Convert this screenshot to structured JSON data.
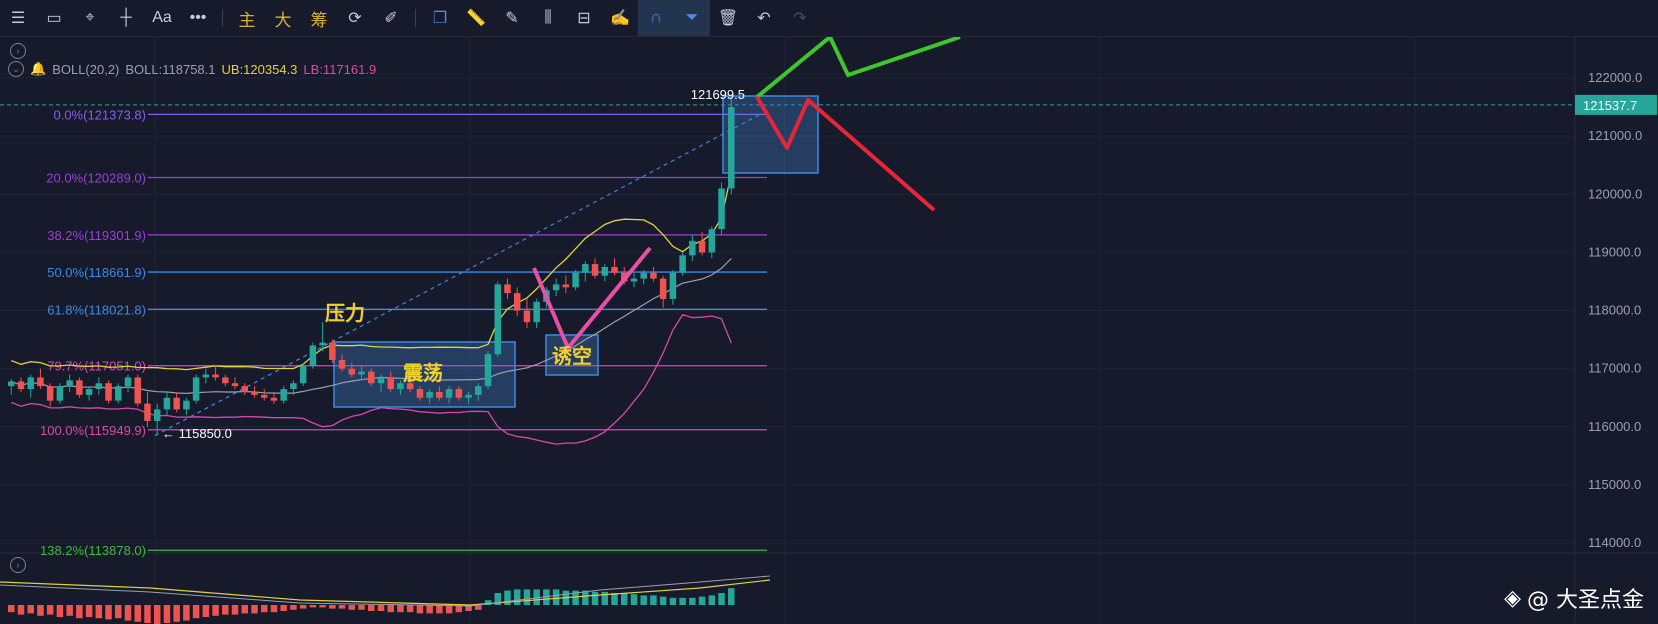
{
  "toolbar": {
    "main_label": "主",
    "big_label": "大",
    "chip_label": "筹",
    "text_tool_label": "Aa"
  },
  "indicator": {
    "name": "BOLL(20,2)",
    "boll": "BOLL:118758.1",
    "ub": "UB:120354.3",
    "lb": "LB:117161.9",
    "colors": {
      "boll": "#9aa0ae",
      "ub": "#e0d23a",
      "lb": "#d94aa8"
    }
  },
  "watermark": "@ 大圣点金",
  "chart_data": {
    "type": "candlestick",
    "y_axis": {
      "range": [
        113600,
        122600
      ],
      "ticks": [
        "122000.0",
        "121000.0",
        "120000.0",
        "119000.0",
        "118000.0",
        "117000.0",
        "116000.0",
        "115000.0",
        "114000.0"
      ],
      "tick_values": [
        122000,
        121000,
        120000,
        119000,
        118000,
        117000,
        116000,
        115000,
        114000
      ]
    },
    "current_price": "121537.7",
    "current_price_value": 121537.7,
    "high_label": "121699.5",
    "low_label": "115850.0",
    "fib_levels": [
      {
        "label": "0.0%(121373.8)",
        "value": 121373.8,
        "color": "#8a5cf0"
      },
      {
        "label": "20.0%(120289.0)",
        "value": 120289.0,
        "color": "#9b3fd8"
      },
      {
        "label": "38.2%(119301.9)",
        "value": 119301.9,
        "color": "#9b3fd8"
      },
      {
        "label": "50.0%(118661.9)",
        "value": 118661.9,
        "color": "#3d8ae0"
      },
      {
        "label": "61.8%(118021.8)",
        "value": 118021.8,
        "color": "#3d8ae0"
      },
      {
        "label": "79.7%(117051.0)",
        "value": 117051.0,
        "color": "#d94aa8"
      },
      {
        "label": "100.0%(115949.9)",
        "value": 115949.9,
        "color": "#d94aa8"
      },
      {
        "label": "138.2%(113878.0)",
        "value": 113878.0,
        "color": "#3fb83f"
      }
    ],
    "annotations": [
      {
        "text": "压力",
        "color": "#f2d22a"
      },
      {
        "text": "震荡",
        "color": "#f2d22a"
      },
      {
        "text": "诱空",
        "color": "#f2d22a"
      }
    ],
    "candles": [
      [
        116700,
        116820,
        116550,
        116780
      ],
      [
        116780,
        116850,
        116600,
        116650
      ],
      [
        116650,
        116900,
        116500,
        116850
      ],
      [
        116850,
        117000,
        116650,
        116700
      ],
      [
        116700,
        116750,
        116350,
        116450
      ],
      [
        116450,
        116750,
        116400,
        116700
      ],
      [
        116700,
        116900,
        116600,
        116800
      ],
      [
        116800,
        116850,
        116500,
        116550
      ],
      [
        116550,
        116700,
        116450,
        116650
      ],
      [
        116650,
        116850,
        116550,
        116750
      ],
      [
        116750,
        116800,
        116400,
        116450
      ],
      [
        116450,
        116750,
        116400,
        116700
      ],
      [
        116700,
        116900,
        116600,
        116850
      ],
      [
        116850,
        116900,
        116350,
        116400
      ],
      [
        116400,
        116600,
        116000,
        116100
      ],
      [
        116100,
        116400,
        115850,
        116300
      ],
      [
        116300,
        116600,
        116200,
        116500
      ],
      [
        116500,
        116600,
        116250,
        116300
      ],
      [
        116300,
        116500,
        116200,
        116450
      ],
      [
        116450,
        116900,
        116400,
        116850
      ],
      [
        116850,
        117000,
        116750,
        116900
      ],
      [
        116900,
        117050,
        116800,
        116850
      ],
      [
        116850,
        116900,
        116700,
        116750
      ],
      [
        116750,
        116850,
        116650,
        116700
      ],
      [
        116700,
        116750,
        116550,
        116600
      ],
      [
        116600,
        116700,
        116500,
        116550
      ],
      [
        116550,
        116650,
        116450,
        116500
      ],
      [
        116500,
        116600,
        116400,
        116450
      ],
      [
        116450,
        116700,
        116400,
        116650
      ],
      [
        116650,
        116800,
        116550,
        116750
      ],
      [
        116750,
        117100,
        116700,
        117050
      ],
      [
        117050,
        117450,
        117000,
        117400
      ],
      [
        117400,
        117800,
        117300,
        117450
      ],
      [
        117450,
        117500,
        117100,
        117150
      ],
      [
        117150,
        117250,
        116950,
        117000
      ],
      [
        117000,
        117100,
        116850,
        116900
      ],
      [
        116900,
        117050,
        116800,
        116950
      ],
      [
        116950,
        117000,
        116700,
        116750
      ],
      [
        116750,
        116900,
        116600,
        116850
      ],
      [
        116850,
        116950,
        116600,
        116650
      ],
      [
        116650,
        116800,
        116550,
        116750
      ],
      [
        116750,
        116900,
        116600,
        116650
      ],
      [
        116650,
        116700,
        116450,
        116500
      ],
      [
        116500,
        116650,
        116400,
        116600
      ],
      [
        116600,
        116700,
        116450,
        116500
      ],
      [
        116500,
        116700,
        116400,
        116650
      ],
      [
        116650,
        116700,
        116450,
        116500
      ],
      [
        116500,
        116600,
        116400,
        116550
      ],
      [
        116550,
        116750,
        116450,
        116700
      ],
      [
        116700,
        117300,
        116650,
        117250
      ],
      [
        117250,
        118500,
        117200,
        118450
      ],
      [
        118450,
        118550,
        118200,
        118300
      ],
      [
        118300,
        118400,
        117900,
        118000
      ],
      [
        118000,
        118200,
        117700,
        117800
      ],
      [
        117800,
        118200,
        117700,
        118150
      ],
      [
        118150,
        118400,
        118050,
        118350
      ],
      [
        118350,
        118550,
        118250,
        118450
      ],
      [
        118450,
        118600,
        118300,
        118400
      ],
      [
        118400,
        118700,
        118350,
        118650
      ],
      [
        118650,
        118850,
        118500,
        118800
      ],
      [
        118800,
        118900,
        118550,
        118600
      ],
      [
        118600,
        118800,
        118500,
        118750
      ],
      [
        118750,
        118900,
        118600,
        118650
      ],
      [
        118650,
        118750,
        118450,
        118500
      ],
      [
        118500,
        118650,
        118400,
        118550
      ],
      [
        118550,
        118700,
        118450,
        118650
      ],
      [
        118650,
        118750,
        118500,
        118550
      ],
      [
        118550,
        118600,
        118050,
        118200
      ],
      [
        118200,
        118700,
        118100,
        118650
      ],
      [
        118650,
        119000,
        118600,
        118950
      ],
      [
        118950,
        119300,
        118850,
        119200
      ],
      [
        119200,
        119350,
        118950,
        119000
      ],
      [
        119000,
        119450,
        118900,
        119400
      ],
      [
        119400,
        120200,
        119300,
        120100
      ],
      [
        120100,
        121699.5,
        120000,
        121500
      ]
    ],
    "volume": [
      -0.6,
      -0.8,
      -0.7,
      -0.9,
      -0.8,
      -1.0,
      -0.9,
      -1.1,
      -1.0,
      -1.1,
      -1.2,
      -1.1,
      -1.3,
      -1.4,
      -1.5,
      -1.6,
      -1.5,
      -1.4,
      -1.3,
      -1.1,
      -1.0,
      -0.9,
      -0.8,
      -0.8,
      -0.7,
      -0.7,
      -0.6,
      -0.6,
      -0.5,
      -0.4,
      -0.3,
      -0.2,
      -0.2,
      -0.3,
      -0.3,
      -0.4,
      -0.4,
      -0.5,
      -0.5,
      -0.6,
      -0.6,
      -0.6,
      -0.7,
      -0.7,
      -0.7,
      -0.7,
      -0.6,
      -0.5,
      -0.4,
      0.4,
      1.0,
      1.2,
      1.3,
      1.3,
      1.3,
      1.3,
      1.3,
      1.2,
      1.2,
      1.2,
      1.1,
      1.1,
      1.0,
      1.0,
      0.9,
      0.8,
      0.8,
      0.7,
      0.6,
      0.6,
      0.6,
      0.7,
      0.8,
      1.0,
      1.4
    ]
  }
}
